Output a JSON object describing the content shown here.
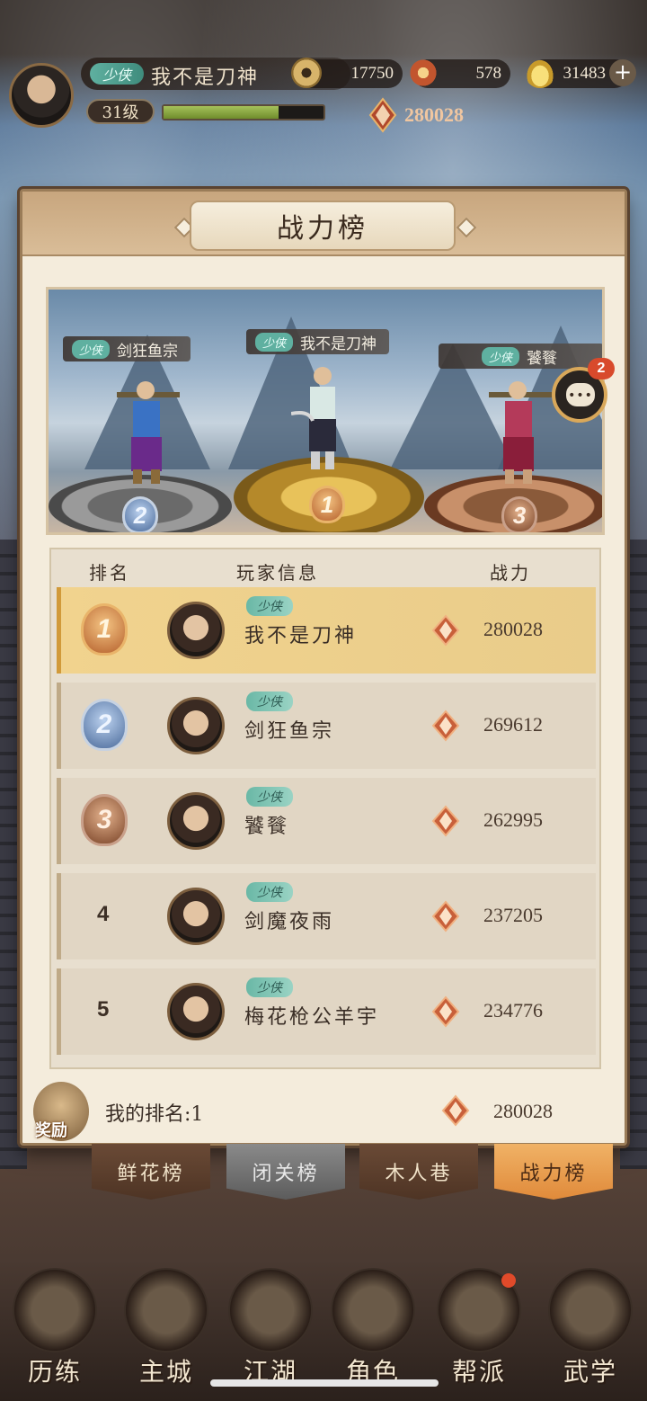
{
  "player": {
    "title": "少侠",
    "name": "我不是刀神",
    "level": "31级",
    "exp_progress": 0.72,
    "power": "280028"
  },
  "resources": [
    {
      "name": "coin",
      "icon": "coin-icon",
      "value": "17750"
    },
    {
      "name": "flower",
      "icon": "flower-icon",
      "value": "578"
    },
    {
      "name": "ingot",
      "icon": "gold-ingot-icon",
      "value": "31483"
    }
  ],
  "panel": {
    "title": "战力榜"
  },
  "podium": [
    {
      "rank": "2",
      "title": "少侠",
      "name": "剑狂鱼宗"
    },
    {
      "rank": "1",
      "title": "少侠",
      "name": "我不是刀神"
    },
    {
      "rank": "3",
      "title": "少侠",
      "name": "饕餮"
    }
  ],
  "table": {
    "headers": {
      "rank": "排名",
      "info": "玩家信息",
      "power": "战力"
    },
    "rows": [
      {
        "rank": "1",
        "title": "少侠",
        "name": "我不是刀神",
        "power": "280028"
      },
      {
        "rank": "2",
        "title": "少侠",
        "name": "剑狂鱼宗",
        "power": "269612"
      },
      {
        "rank": "3",
        "title": "少侠",
        "name": "饕餮",
        "power": "262995"
      },
      {
        "rank": "4",
        "title": "少侠",
        "name": "剑魔夜雨",
        "power": "237205"
      },
      {
        "rank": "5",
        "title": "少侠",
        "name": "梅花枪公羊宇",
        "power": "234776"
      }
    ]
  },
  "chat": {
    "badge": "2",
    "dots": "•••"
  },
  "myrank": {
    "reward_label": "奖励",
    "text": "我的排名:1",
    "power": "280028"
  },
  "subtabs": [
    {
      "label": "鲜花榜",
      "state": "normal"
    },
    {
      "label": "闭关榜",
      "state": "locked"
    },
    {
      "label": "木人巷",
      "state": "normal"
    },
    {
      "label": "战力榜",
      "state": "active"
    }
  ],
  "bottom_nav": [
    {
      "label": "历练"
    },
    {
      "label": "主城"
    },
    {
      "label": "江湖"
    },
    {
      "label": "角色"
    },
    {
      "label": "帮派"
    },
    {
      "label": "武学"
    }
  ],
  "colors": {
    "gold_accent": "#e9b46a",
    "panel_bg": "#f4ecdc",
    "active_tab": "#f0b266",
    "badge_red": "#d84a2c"
  }
}
